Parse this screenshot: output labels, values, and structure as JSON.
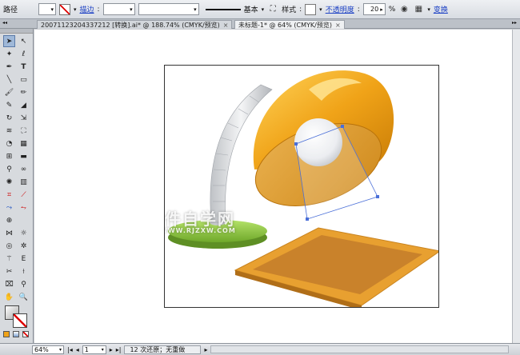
{
  "control_bar": {
    "path_label": "路径",
    "stroke_label": "描边",
    "stroke_value": "",
    "profile_label": "基本",
    "style_label": "样式",
    "opacity_label": "不透明度",
    "opacity_value": "20",
    "opacity_unit": "%",
    "transform_label": "变换"
  },
  "tabs": [
    {
      "label": "20071123204337212 [转换].ai* @ 188.74% (CMYK/预览)",
      "active": false
    },
    {
      "label": "未标题-1* @ 64% (CMYK/预览)",
      "active": true
    }
  ],
  "tab_close_symbol": "×",
  "panel_collapse_symbol": "◂◂",
  "panel_expand_symbol": "▸▸",
  "watermark": {
    "text": "软件自学网",
    "url": "WWW.RJZXW.COM"
  },
  "status_bar": {
    "zoom": "64%",
    "page": "1",
    "status": "12 次还原；无重做"
  },
  "colors": {
    "lamp_orange": "#f0a318",
    "lamp_orange_dark": "#c97c06",
    "base_green": "#8cc63e",
    "mat_orange": "#e8a030",
    "mat_inner": "#c9822b"
  }
}
